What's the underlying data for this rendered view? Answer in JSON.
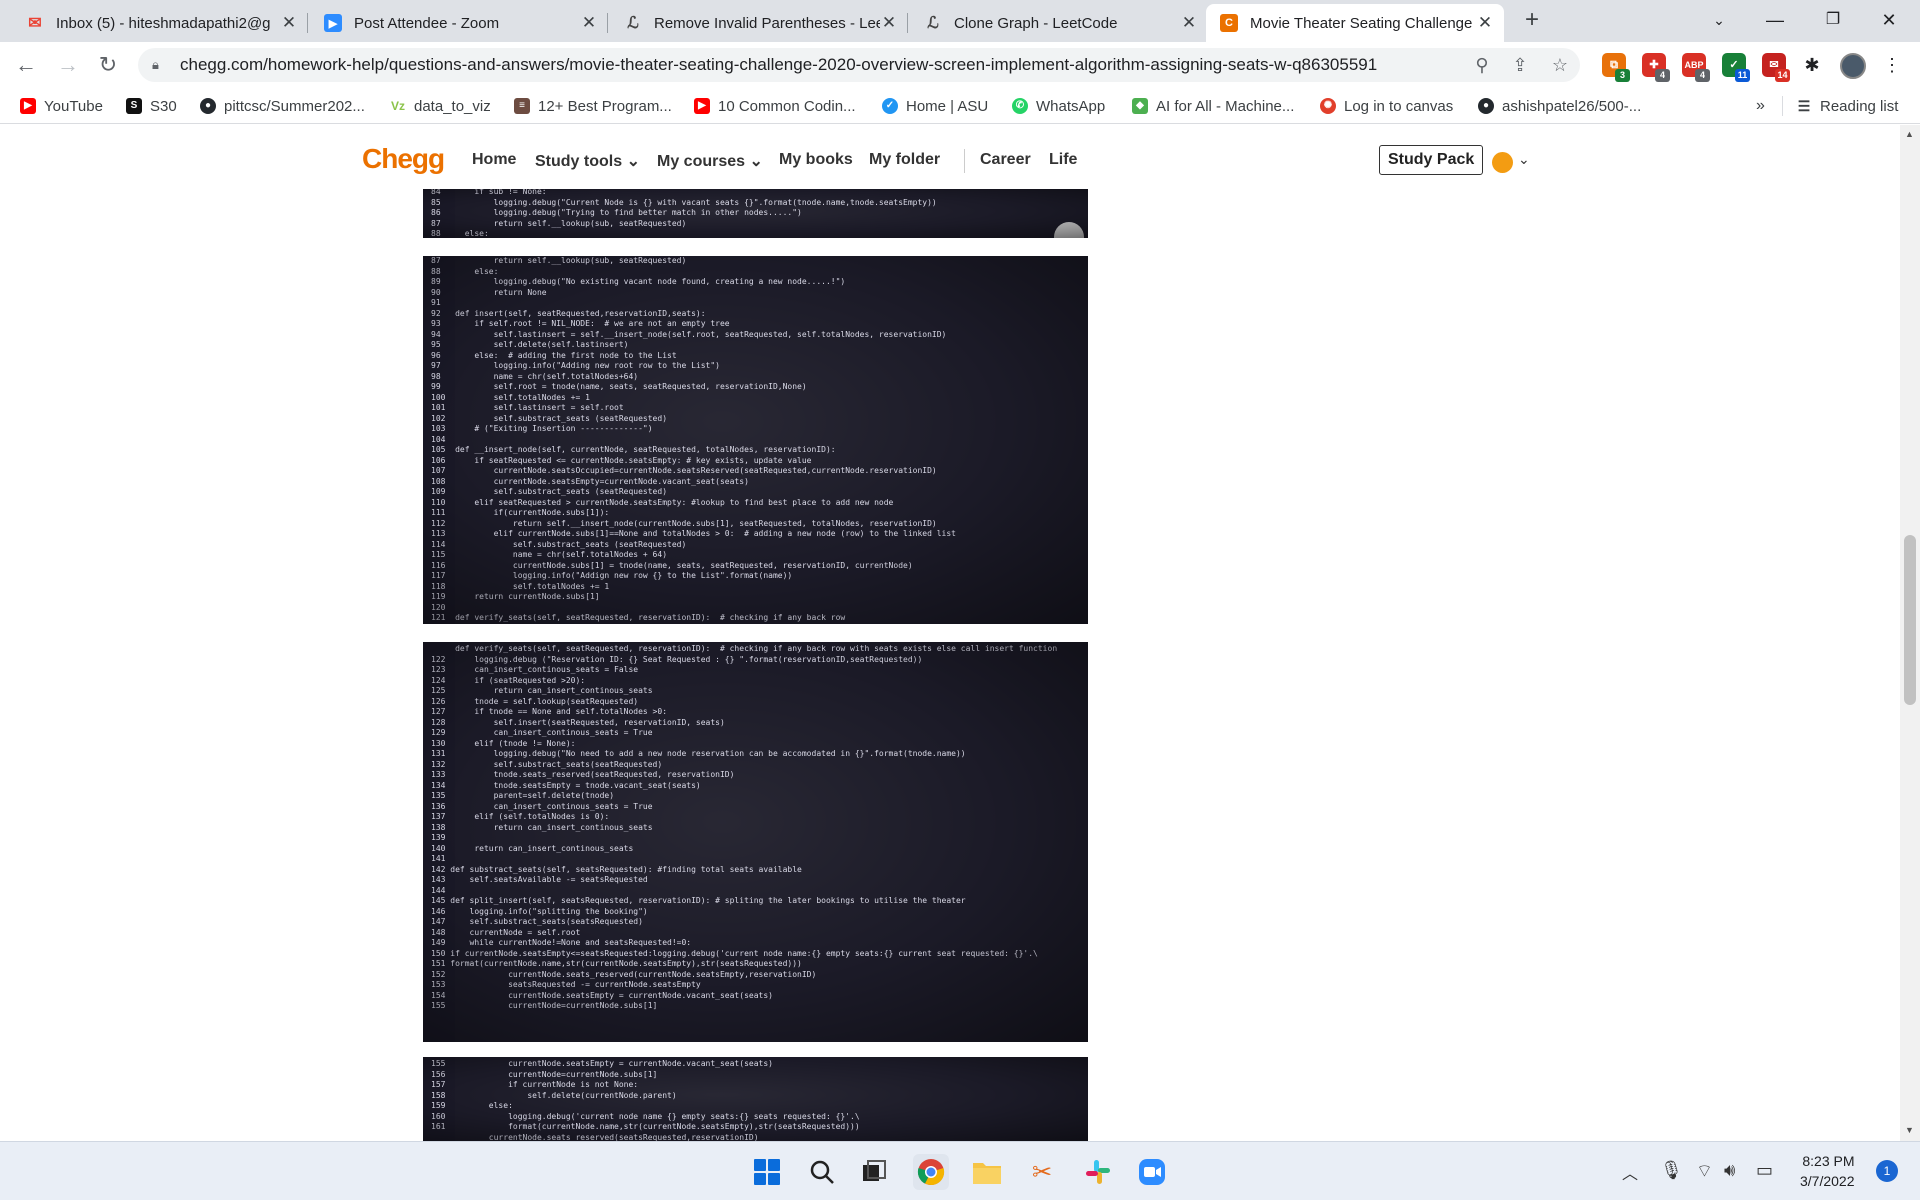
{
  "browser": {
    "tabs": [
      {
        "title": "Inbox (5) - hiteshmadapathi2@g",
        "icon": "gmail-icon",
        "color": "#ea4335",
        "active": false
      },
      {
        "title": "Post Attendee - Zoom",
        "icon": "zoom-icon",
        "color": "#2d8cff",
        "active": false
      },
      {
        "title": "Remove Invalid Parentheses - Lee",
        "icon": "leetcode-icon",
        "color": "#444444",
        "active": false
      },
      {
        "title": "Clone Graph - LeetCode",
        "icon": "leetcode-icon",
        "color": "#444444",
        "active": false
      },
      {
        "title": "Movie Theater Seating Challenge",
        "icon": "chegg-icon",
        "color": "#eb7100",
        "active": true
      }
    ],
    "new_tab": "+",
    "url": "chegg.com/homework-help/questions-and-answers/movie-theater-seating-challenge-2020-overview-screen-implement-algorithm-assigning-seats-w-q86305591",
    "extensions": [
      {
        "name": "extension-1",
        "color": "#e8710a",
        "badge": "3"
      },
      {
        "name": "extension-2",
        "color": "#d93025",
        "badge": "4"
      },
      {
        "name": "adblock-extension",
        "color": "#d93025",
        "badge": "4",
        "text": "ABP"
      },
      {
        "name": "extension-4",
        "color": "#188038",
        "badge": "11"
      },
      {
        "name": "extension-5",
        "color": "#c5221f",
        "badge": "14"
      }
    ],
    "bookmarks": [
      {
        "label": "YouTube",
        "icon": "youtube-icon",
        "color": "#ff0000"
      },
      {
        "label": "S30",
        "icon": "s30-icon",
        "color": "#111111"
      },
      {
        "label": "pittcsc/Summer202...",
        "icon": "github-icon",
        "color": "#24292e"
      },
      {
        "label": "data_to_viz",
        "icon": "viz-icon",
        "color": "#8bc34a"
      },
      {
        "label": "12+ Best Program...",
        "icon": "stack-icon",
        "color": "#6d4c41"
      },
      {
        "label": "10 Common Codin...",
        "icon": "youtube-icon",
        "color": "#ff0000"
      },
      {
        "label": "Home | ASU",
        "icon": "asu-icon",
        "color": "#2196f3"
      },
      {
        "label": "WhatsApp",
        "icon": "whatsapp-icon",
        "color": "#25d366"
      },
      {
        "label": "AI for All - Machine...",
        "icon": "ai-icon",
        "color": "#4caf50"
      },
      {
        "label": "Log in to canvas",
        "icon": "canvas-icon",
        "color": "#e13f2b"
      },
      {
        "label": "ashishpatel26/500-...",
        "icon": "github-icon",
        "color": "#24292e"
      }
    ],
    "bookmarks_overflow": "»",
    "reading_list": "Reading list"
  },
  "chegg": {
    "logo": "Chegg",
    "nav": [
      "Home",
      "Study tools",
      "My courses",
      "My books",
      "My folder",
      "Career",
      "Life"
    ],
    "study_pack": "Study Pack",
    "code_images": [
      {
        "lines": "84       if sub != None:\n85           logging.debug(\"Current Node is {} with vacant seats {}\".format(tnode.name,tnode.seatsEmpty))\n86           logging.debug(\"Trying to find better match in other nodes.....\")\n87           return self.__lookup(sub, seatRequested)\n88     else:"
      },
      {
        "lines": "87           return self.__lookup(sub, seatRequested)\n88       else:\n89           logging.debug(\"No existing vacant node found, creating a new node.....!\")\n90           return None\n91\n92   def insert(self, seatRequested,reservationID,seats):\n93       if self.root != NIL_NODE:  # we are not an empty tree\n94           self.lastinsert = self.__insert_node(self.root, seatRequested, self.totalNodes, reservationID)\n95           self.delete(self.lastinsert)\n96       else:  # adding the first node to the List\n97           logging.info(\"Adding new root row to the List\")\n98           name = chr(self.totalNodes+64)\n99           self.root = tnode(name, seats, seatRequested, reservationID,None)\n100          self.totalNodes += 1\n101          self.lastinsert = self.root\n102          self.substract_seats (seatRequested)\n103      # (\"Exiting Insertion -------------\")\n104\n105  def __insert_node(self, currentNode, seatRequested, totalNodes, reservationID):\n106      if seatRequested <= currentNode.seatsEmpty: # key exists, update value\n107          currentNode.seatsOccupied=currentNode.seatsReserved(seatRequested,currentNode.reservationID)\n108          currentNode.seatsEmpty=currentNode.vacant_seat(seats)\n109          self.substract_seats (seatRequested)\n110      elif seatRequested > currentNode.seatsEmpty: #lookup to find best place to add new node\n111          if(currentNode.subs[1]):\n112              return self.__insert_node(currentNode.subs[1], seatRequested, totalNodes, reservationID)\n113          elif currentNode.subs[1]==None and totalNodes > 0:  # adding a new node (row) to the linked list\n114              self.substract_seats (seatRequested)\n115              name = chr(self.totalNodes + 64)\n116              currentNode.subs[1] = tnode(name, seats, seatRequested, reservationID, currentNode)\n117              logging.info(\"Addign new row {} to the List\".format(name))\n118              self.totalNodes += 1\n119      return currentNode.subs[1]\n120\n121  def verify_seats(self, seatRequested, reservationID):  # checking if any back row"
      },
      {
        "lines": "     def verify_seats(self, seatRequested, reservationID):  # checking if any back row with seats exists else call insert function\n122      logging.debug (\"Reservation ID: {} Seat Requested : {} \".format(reservationID,seatRequested))\n123      can_insert_continous_seats = False\n124      if (seatRequested >20):\n125          return can_insert_continous_seats\n126      tnode = self.lookup(seatRequested)\n127      if tnode == None and self.totalNodes >0:\n128          self.insert(seatRequested, reservationID, seats)\n129          can_insert_continous_seats = True\n130      elif (tnode != None):\n131          logging.debug(\"No need to add a new node reservation can be accomodated in {}\".format(tnode.name))\n132          self.substract_seats(seatRequested)\n133          tnode.seats_reserved(seatRequested, reservationID)\n134          tnode.seatsEmpty = tnode.vacant_seat(seats)\n135          parent=self.delete(tnode)\n136          can_insert_continous_seats = True\n137      elif (self.totalNodes is 0):\n138          return can_insert_continous_seats\n139\n140      return can_insert_continous_seats\n141\n142 def substract_seats(self, seatsRequested): #finding total seats available\n143     self.seatsAvailable -= seatsRequested\n144\n145 def split_insert(self, seatsRequested, reservationID): # spliting the later bookings to utilise the theater\n146     logging.info(\"splitting the booking\")\n147     self.substract_seats(seatsRequested)\n148     currentNode = self.root\n149     while currentNode!=None and seatsRequested!=0:\n150 if currentNode.seatsEmpty<=seatsRequested:logging.debug('current node name:{} empty seats:{} current seat requested: {}'.\\\n151 format(currentNode.name,str(currentNode.seatsEmpty),str(seatsRequested)))\n152             currentNode.seats_reserved(currentNode.seatsEmpty,reservationID)\n153             seatsRequested -= currentNode.seatsEmpty\n154             currentNode.seatsEmpty = currentNode.vacant_seat(seats)\n155             currentNode=currentNode.subs[1]"
      },
      {
        "lines": "155             currentNode.seatsEmpty = currentNode.vacant_seat(seats)\n156             currentNode=currentNode.subs[1]\n157             if currentNode is not None:\n158                 self.delete(currentNode.parent)\n159         else:\n160             logging.debug('current node name {} empty seats:{} seats requested: {}'.\\\n161             format(currentNode.name,str(currentNode.seatsEmpty),str(seatsRequested)))\n            currentNode.seats_reserved(seatsRequested,reservationID)"
      }
    ]
  },
  "taskbar": {
    "apps": [
      "windows-start-icon",
      "search-icon",
      "task-view-icon",
      "chrome-icon",
      "file-explorer-icon",
      "snipping-tool-icon",
      "slack-icon",
      "zoom-icon"
    ],
    "time": "8:23 PM",
    "date": "3/7/2022",
    "notifications": "1"
  }
}
